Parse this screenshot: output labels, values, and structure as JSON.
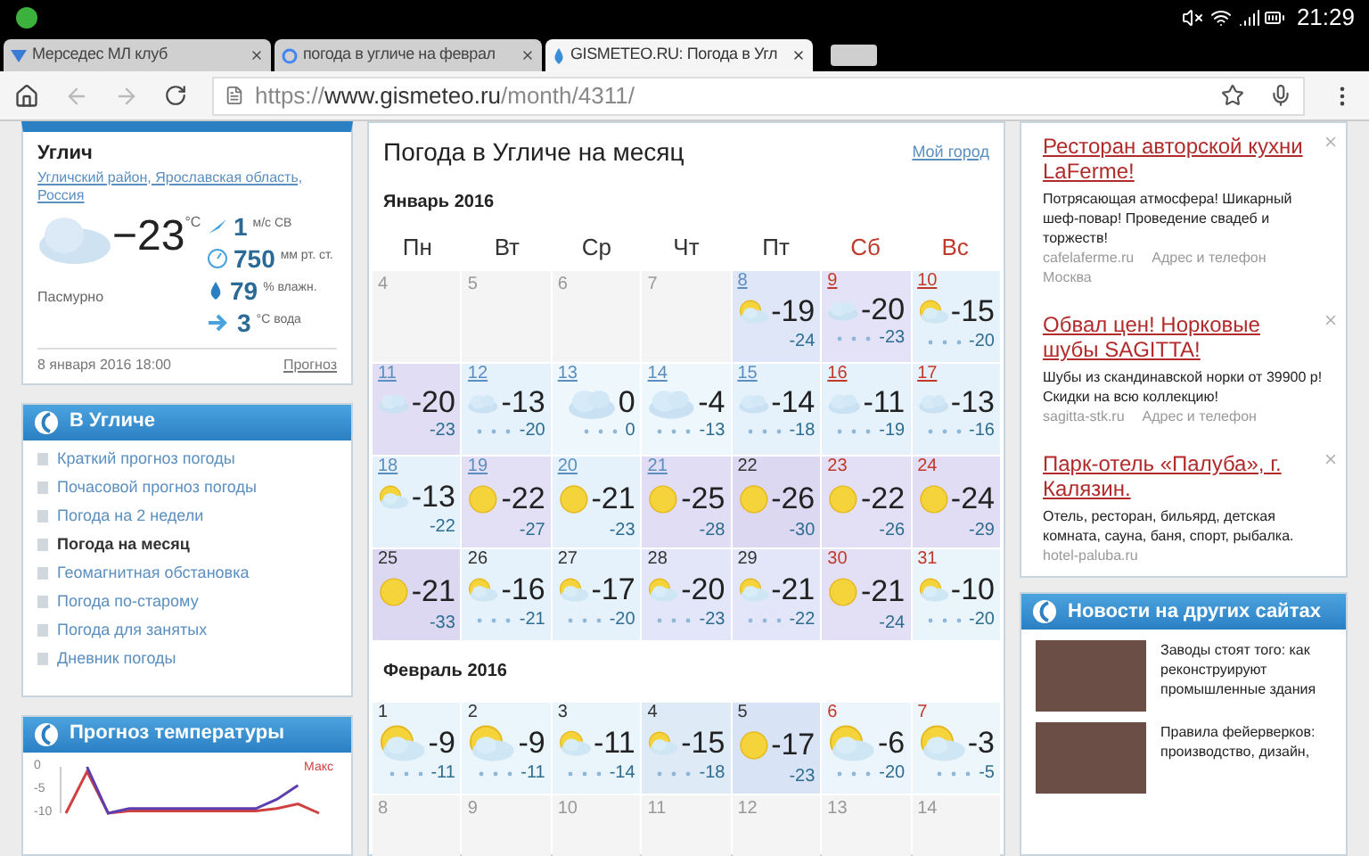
{
  "status_bar": {
    "time": "21:29"
  },
  "tabs": [
    {
      "label": "Мерседес МЛ клуб",
      "selected": false
    },
    {
      "label": "погода в угличе на феврал",
      "selected": false
    },
    {
      "label": "GISMETEO.RU: Погода в Угл",
      "selected": true
    }
  ],
  "address_bar": {
    "scheme": "https://",
    "host": "www.gismeteo.ru",
    "path": "/month/4311/"
  },
  "current": {
    "city": "Углич",
    "region": "Угличский район, Ярославская область, Россия",
    "temp": "−23",
    "unit": "°C",
    "condition": "Пасмурно",
    "stats": [
      {
        "kind": "wind",
        "value": "1",
        "unit": "м/с  СВ"
      },
      {
        "kind": "pressure",
        "value": "750",
        "unit": "мм рт. ст."
      },
      {
        "kind": "humidity",
        "value": "79",
        "unit": "% влажн."
      },
      {
        "kind": "water",
        "value": "3",
        "unit": "°С вода"
      }
    ],
    "date": "8 января 2016 18:00",
    "forecast_link": "Прогноз"
  },
  "city_menu": {
    "title": "В Угличе",
    "items": [
      {
        "label": "Краткий прогноз погоды",
        "selected": false
      },
      {
        "label": "Почасовой прогноз погоды",
        "selected": false
      },
      {
        "label": "Погода на 2 недели",
        "selected": false
      },
      {
        "label": "Погода на месяц",
        "selected": true
      },
      {
        "label": "Геомагнитная обстановка",
        "selected": false
      },
      {
        "label": "Погода по-старому",
        "selected": false
      },
      {
        "label": "Погода для занятых",
        "selected": false
      },
      {
        "label": "Дневник погоды",
        "selected": false
      }
    ]
  },
  "temp_chart": {
    "title": "Прогноз температуры",
    "chart_data": {
      "type": "line",
      "ylim": [
        -10,
        0
      ],
      "yticks": [
        0,
        -5,
        -10
      ],
      "series": [
        {
          "name": "Макс",
          "color": "#d04040",
          "values": [
            -10,
            -1,
            -10,
            -9.5,
            -9.5,
            -9.5,
            -9.5,
            -9.5,
            -9.5,
            -9.5,
            -9,
            -8,
            -10
          ]
        },
        {
          "color": "#5b3fb0",
          "values": [
            null,
            0,
            -10,
            -9,
            -9,
            -9,
            -9,
            -9,
            -9,
            -9,
            -7,
            -4,
            null
          ]
        }
      ]
    }
  },
  "calendar": {
    "title": "Погода в Угличе на месяц",
    "my_city": "Мой город",
    "weekdays": [
      {
        "label": "Пн",
        "weekend": false
      },
      {
        "label": "Вт",
        "weekend": false
      },
      {
        "label": "Ср",
        "weekend": false
      },
      {
        "label": "Чт",
        "weekend": false
      },
      {
        "label": "Пт",
        "weekend": false
      },
      {
        "label": "Сб",
        "weekend": true
      },
      {
        "label": "Вс",
        "weekend": true
      }
    ],
    "months": [
      {
        "title": "Январь 2016",
        "weeks": [
          [
            {
              "day": "4",
              "kind": "empty"
            },
            {
              "day": "5",
              "kind": "empty"
            },
            {
              "day": "6",
              "kind": "empty"
            },
            {
              "day": "7",
              "kind": "empty"
            },
            {
              "day": "8",
              "kind": "partly",
              "link": true,
              "temp": "-19",
              "night": "-24",
              "snow": false,
              "color": "#dfe6f8"
            },
            {
              "day": "9",
              "kind": "cloud",
              "link": true,
              "temp": "-20",
              "night": "-23",
              "snow": true,
              "color": "#e4e2f6"
            },
            {
              "day": "10",
              "kind": "partly",
              "link": true,
              "temp": "-15",
              "night": "-20",
              "snow": true,
              "color": "#e6f2fb"
            }
          ],
          [
            {
              "day": "11",
              "kind": "cloud",
              "link": true,
              "temp": "-20",
              "night": "-23",
              "snow": false,
              "color": "#e0ddf4"
            },
            {
              "day": "12",
              "kind": "cloud",
              "link": true,
              "temp": "-13",
              "night": "-20",
              "snow": true,
              "color": "#e6f2fb"
            },
            {
              "day": "13",
              "kind": "cloud",
              "link": true,
              "temp": "0",
              "night": "0",
              "snow": true,
              "color": "#eef8fc"
            },
            {
              "day": "14",
              "kind": "cloud",
              "link": true,
              "temp": "-4",
              "night": "-13",
              "snow": true,
              "color": "#eef8fc"
            },
            {
              "day": "15",
              "kind": "cloud",
              "link": true,
              "temp": "-14",
              "night": "-18",
              "snow": true,
              "color": "#e6f2fb"
            },
            {
              "day": "16",
              "kind": "cloud",
              "link": true,
              "temp": "-11",
              "night": "-19",
              "snow": true,
              "color": "#e6f2fb"
            },
            {
              "day": "17",
              "kind": "cloud",
              "link": true,
              "temp": "-13",
              "night": "-16",
              "snow": true,
              "color": "#e6f2fb"
            }
          ],
          [
            {
              "day": "18",
              "kind": "partly",
              "link": true,
              "temp": "-13",
              "night": "-22",
              "snow": false,
              "color": "#e6f2fb"
            },
            {
              "day": "19",
              "kind": "sun",
              "link": true,
              "temp": "-22",
              "night": "-27",
              "snow": false,
              "color": "#e3e0f6"
            },
            {
              "day": "20",
              "kind": "sun",
              "link": true,
              "temp": "-21",
              "night": "-23",
              "snow": false,
              "color": "#e6f2fb"
            },
            {
              "day": "21",
              "kind": "sun",
              "link": true,
              "temp": "-25",
              "night": "-28",
              "snow": false,
              "color": "#e0ddf4"
            },
            {
              "day": "22",
              "kind": "sun",
              "link": false,
              "temp": "-26",
              "night": "-30",
              "snow": false,
              "color": "#dcd8f2"
            },
            {
              "day": "23",
              "kind": "sun",
              "link": false,
              "temp": "-22",
              "night": "-26",
              "snow": false,
              "color": "#e3e0f6"
            },
            {
              "day": "24",
              "kind": "sun",
              "link": false,
              "temp": "-24",
              "night": "-29",
              "snow": false,
              "color": "#e0ddf4"
            }
          ],
          [
            {
              "day": "25",
              "kind": "sun",
              "link": false,
              "temp": "-21",
              "night": "-33",
              "snow": false,
              "color": "#dcd8f2"
            },
            {
              "day": "26",
              "kind": "partly",
              "link": false,
              "temp": "-16",
              "night": "-21",
              "snow": true,
              "color": "#e6f2fb"
            },
            {
              "day": "27",
              "kind": "partly",
              "link": false,
              "temp": "-17",
              "night": "-20",
              "snow": true,
              "color": "#e6f2fb"
            },
            {
              "day": "28",
              "kind": "partly",
              "link": false,
              "temp": "-20",
              "night": "-23",
              "snow": true,
              "color": "#e3e6f8"
            },
            {
              "day": "29",
              "kind": "partly",
              "link": false,
              "temp": "-21",
              "night": "-22",
              "snow": true,
              "color": "#e3e6f8"
            },
            {
              "day": "30",
              "kind": "sun",
              "link": false,
              "temp": "-21",
              "night": "-24",
              "snow": false,
              "color": "#e3e0f6"
            },
            {
              "day": "31",
              "kind": "partly",
              "link": false,
              "temp": "-10",
              "night": "-20",
              "snow": true,
              "color": "#eaf5fb"
            }
          ]
        ]
      },
      {
        "title": "Февраль 2016",
        "weeks": [
          [
            {
              "day": "1",
              "kind": "partly",
              "link": false,
              "temp": "-9",
              "night": "-11",
              "snow": true,
              "color": "#eaf5fb"
            },
            {
              "day": "2",
              "kind": "partly",
              "link": false,
              "temp": "-9",
              "night": "-11",
              "snow": true,
              "color": "#eaf5fc"
            },
            {
              "day": "3",
              "kind": "partly",
              "link": false,
              "temp": "-11",
              "night": "-14",
              "snow": true,
              "color": "#e9f4fb"
            },
            {
              "day": "4",
              "kind": "partly",
              "link": false,
              "temp": "-15",
              "night": "-18",
              "snow": true,
              "color": "#dfeaf7"
            },
            {
              "day": "5",
              "kind": "sun",
              "link": false,
              "temp": "-17",
              "night": "-23",
              "snow": false,
              "color": "#d8e4f5"
            },
            {
              "day": "6",
              "kind": "partly",
              "link": false,
              "temp": "-6",
              "night": "-20",
              "snow": true,
              "color": "#ebf5fb"
            },
            {
              "day": "7",
              "kind": "partly",
              "link": false,
              "temp": "-3",
              "night": "-5",
              "snow": true,
              "color": "#ecf6fb"
            }
          ],
          [
            {
              "day": "8",
              "kind": "empty"
            },
            {
              "day": "9",
              "kind": "empty"
            },
            {
              "day": "10",
              "kind": "empty"
            },
            {
              "day": "11",
              "kind": "empty"
            },
            {
              "day": "12",
              "kind": "empty"
            },
            {
              "day": "13",
              "kind": "empty"
            },
            {
              "day": "14",
              "kind": "empty"
            }
          ]
        ]
      }
    ]
  },
  "ads": [
    {
      "title": "Ресторан авторской кухни LaFerme!",
      "text": "Потрясающая атмосфера! Шикарный шеф-повар! Проведение свадеб и торжеств!",
      "domain": "cafelaferme.ru",
      "contact": "Адрес и телефон",
      "city": "Москва"
    },
    {
      "title": "Обвал цен! Норковые шубы SAGITTA!",
      "text": "Шубы из скандинавской норки от 39900 р! Скидки на всю коллекцию!",
      "domain": "sagitta-stk.ru",
      "contact": "Адрес и телефон"
    },
    {
      "title": "Парк-отель «Палуба», г. Калязин.",
      "text": "Отель, ресторан, бильярд, детская комната, сауна, баня, спорт, рыбалка.",
      "domain": "hotel-paluba.ru"
    }
  ],
  "news": {
    "title": "Новости на других сайтах",
    "items": [
      {
        "text": "Заводы стоят того: как реконструируют промышленные здания"
      },
      {
        "text": "Правила фейерверков: производство, дизайн,"
      }
    ]
  }
}
